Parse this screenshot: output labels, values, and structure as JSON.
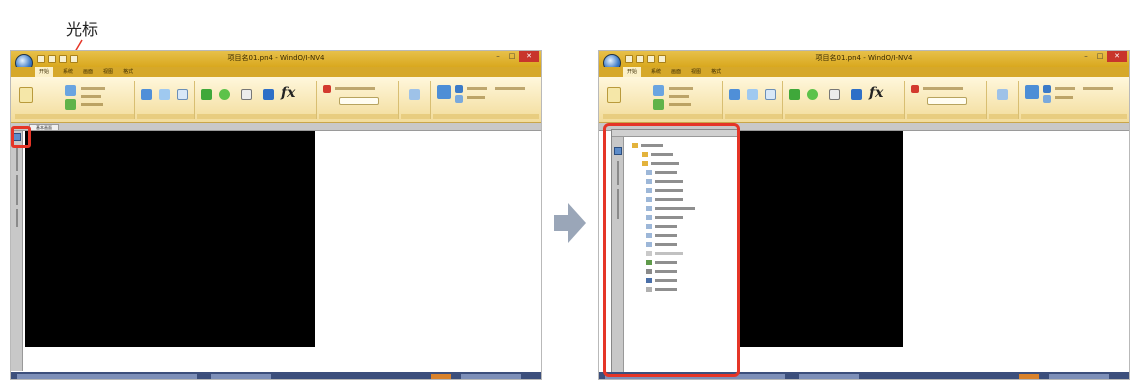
{
  "annotation": {
    "cursor_label": "光标"
  },
  "window": {
    "title": "项目名01.pn4 - WindO/I-NV4",
    "title_right": "项目名01.pn4 - WindO/I-NV4",
    "controls": [
      "–",
      "□",
      "✕"
    ]
  },
  "ribbon": {
    "tabs": [
      "开始",
      "系统",
      "画面",
      "视图",
      "格式"
    ],
    "active_tab": "开始",
    "fx_symbol": "fx",
    "icons": [
      "open-icon",
      "save-icon",
      "copy-icon",
      "picture-icon",
      "text-icon",
      "switch-icon",
      "lamp-icon",
      "numeric-icon",
      "graph-icon",
      "message-icon",
      "download-icon",
      "upload-icon",
      "compare-icon"
    ]
  },
  "document": {
    "tab_label": "基本画面"
  },
  "project_tree": {
    "items": [
      "project01",
      "基本画面",
      "弹出式画面",
      "项目设置",
      "报警日志设置",
      "数据日志设置",
      "操作日志设置",
      "数据寄存器区域管理",
      "外部设备设置",
      "脚本设置",
      "运算程序",
      "用户帐户",
      "系统状态设置",
      "图片管理器",
      "文本管理器",
      "数字管理器",
      "传送数据库"
    ]
  },
  "colors": {
    "titlebar": "#e0b632",
    "highlight": "#e53527",
    "canvas": "#000000",
    "statusbar": "#3c4f7c",
    "arrow": "#9aa6b8"
  }
}
